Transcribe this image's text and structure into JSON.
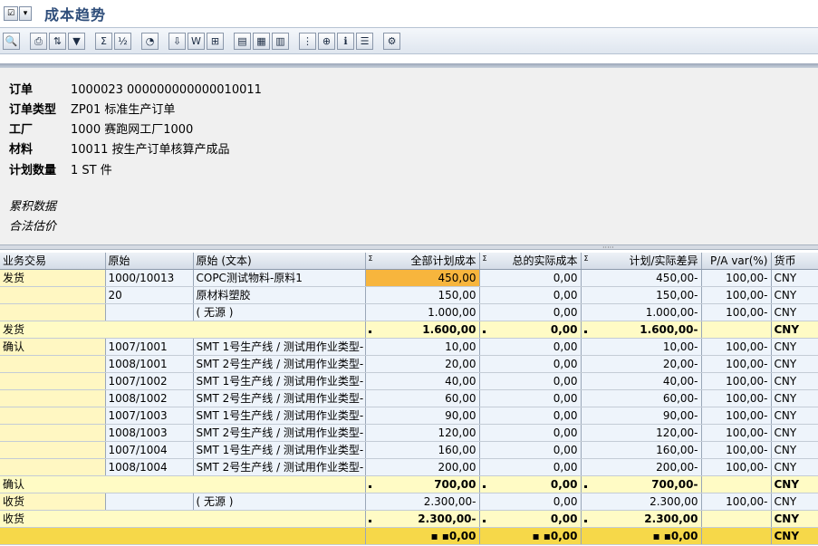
{
  "window": {
    "title": "成本趋势"
  },
  "toolbar": {
    "buttons": [
      {
        "name": "detail-icon",
        "glyph": "🔍"
      },
      {
        "name": "print-icon",
        "glyph": "⎙"
      },
      {
        "name": "sort-icon",
        "glyph": "⇅"
      },
      {
        "name": "filter-icon",
        "glyph": "▼"
      },
      {
        "name": "sum-icon",
        "glyph": "Σ"
      },
      {
        "name": "subtotal-icon",
        "glyph": "½"
      },
      {
        "name": "graphic-icon",
        "glyph": "◔"
      },
      {
        "name": "export-icon",
        "glyph": "⇩"
      },
      {
        "name": "word-icon",
        "glyph": "W"
      },
      {
        "name": "spreadsheet-icon",
        "glyph": "⊞"
      },
      {
        "name": "layout-icon",
        "glyph": "▤"
      },
      {
        "name": "change-layout-icon",
        "glyph": "▦"
      },
      {
        "name": "select-layout-icon",
        "glyph": "▥"
      },
      {
        "name": "hierarchy-icon",
        "glyph": "⋮"
      },
      {
        "name": "tree-icon",
        "glyph": "⊕"
      },
      {
        "name": "info-icon",
        "glyph": "ℹ"
      },
      {
        "name": "list-icon",
        "glyph": "☰"
      },
      {
        "name": "settings-icon",
        "glyph": "⚙"
      }
    ]
  },
  "header": {
    "rows": [
      {
        "label": "订单",
        "value": "1000023 000000000000010011"
      },
      {
        "label": "订单类型",
        "value": "ZP01 标准生产订单"
      },
      {
        "label": "工厂",
        "value": "1000 赛跑网工厂1000"
      },
      {
        "label": "材料",
        "value": "10011 按生产订单核算产成品"
      },
      {
        "label": "计划数量",
        "value": "1 ST 件"
      }
    ],
    "notes": [
      "累积数据",
      "合法估价"
    ]
  },
  "grid": {
    "columns": [
      "业务交易",
      "原始",
      "原始 (文本)",
      "全部计划成本",
      "总的实际成本",
      "计划/实际差异",
      "P/A var(%)",
      "货币"
    ],
    "rows": [
      {
        "type": "item",
        "tx": "发货",
        "orig": "1000/10013",
        "text": "COPC测试物料-原料1",
        "plan": "450,00",
        "actual": "0,00",
        "diff": "450,00-",
        "pct": "100,00-",
        "cur": "CNY",
        "hl": true
      },
      {
        "type": "item",
        "tx": "",
        "orig": "20",
        "text": "原材料塑胶",
        "plan": "150,00",
        "actual": "0,00",
        "diff": "150,00-",
        "pct": "100,00-",
        "cur": "CNY"
      },
      {
        "type": "item",
        "tx": "",
        "orig": "",
        "text": "( 无源 )",
        "plan": "1.000,00",
        "actual": "0,00",
        "diff": "1.000,00-",
        "pct": "100,00-",
        "cur": "CNY"
      },
      {
        "type": "total",
        "tx": "发货",
        "plan": "1.600,00",
        "actual": "0,00",
        "diff": "1.600,00-",
        "pct": "",
        "cur": "CNY"
      },
      {
        "type": "item",
        "tx": "确认",
        "orig": "1007/1001",
        "text": "SMT 1号生产线 / 测试用作业类型-",
        "plan": "10,00",
        "actual": "0,00",
        "diff": "10,00-",
        "pct": "100,00-",
        "cur": "CNY"
      },
      {
        "type": "item",
        "tx": "",
        "orig": "1008/1001",
        "text": "SMT 2号生产线 / 测试用作业类型-",
        "plan": "20,00",
        "actual": "0,00",
        "diff": "20,00-",
        "pct": "100,00-",
        "cur": "CNY"
      },
      {
        "type": "item",
        "tx": "",
        "orig": "1007/1002",
        "text": "SMT 1号生产线 / 测试用作业类型-",
        "plan": "40,00",
        "actual": "0,00",
        "diff": "40,00-",
        "pct": "100,00-",
        "cur": "CNY"
      },
      {
        "type": "item",
        "tx": "",
        "orig": "1008/1002",
        "text": "SMT 2号生产线 / 测试用作业类型-",
        "plan": "60,00",
        "actual": "0,00",
        "diff": "60,00-",
        "pct": "100,00-",
        "cur": "CNY"
      },
      {
        "type": "item",
        "tx": "",
        "orig": "1007/1003",
        "text": "SMT 1号生产线 / 测试用作业类型-",
        "plan": "90,00",
        "actual": "0,00",
        "diff": "90,00-",
        "pct": "100,00-",
        "cur": "CNY"
      },
      {
        "type": "item",
        "tx": "",
        "orig": "1008/1003",
        "text": "SMT 2号生产线 / 测试用作业类型-",
        "plan": "120,00",
        "actual": "0,00",
        "diff": "120,00-",
        "pct": "100,00-",
        "cur": "CNY"
      },
      {
        "type": "item",
        "tx": "",
        "orig": "1007/1004",
        "text": "SMT 1号生产线 / 测试用作业类型-",
        "plan": "160,00",
        "actual": "0,00",
        "diff": "160,00-",
        "pct": "100,00-",
        "cur": "CNY"
      },
      {
        "type": "item",
        "tx": "",
        "orig": "1008/1004",
        "text": "SMT 2号生产线 / 测试用作业类型-",
        "plan": "200,00",
        "actual": "0,00",
        "diff": "200,00-",
        "pct": "100,00-",
        "cur": "CNY"
      },
      {
        "type": "total",
        "tx": "确认",
        "plan": "700,00",
        "actual": "0,00",
        "diff": "700,00-",
        "pct": "",
        "cur": "CNY"
      },
      {
        "type": "item",
        "tx": "收货",
        "orig": "",
        "text": "( 无源 )",
        "plan": "2.300,00-",
        "actual": "0,00",
        "diff": "2.300,00",
        "pct": "100,00-",
        "cur": "CNY"
      },
      {
        "type": "total",
        "tx": "收货",
        "plan": "2.300,00-",
        "actual": "0,00",
        "diff": "2.300,00",
        "pct": "",
        "cur": "CNY"
      },
      {
        "type": "grand",
        "tx": "",
        "plan": "0,00",
        "actual": "0,00",
        "diff": "0,00",
        "pct": "",
        "cur": "CNY"
      }
    ]
  }
}
